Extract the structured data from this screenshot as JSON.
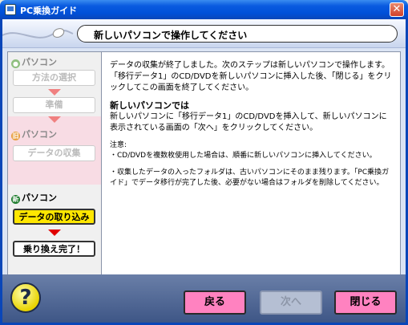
{
  "window": {
    "title": "PC乗換ガイド"
  },
  "header": {
    "title": "新しいパソコンで操作してください"
  },
  "sidebar": {
    "old_label": "パソコン",
    "old_badge": "旧",
    "new_label": "パソコン",
    "new_badge": "新",
    "steps": [
      "方法の選択",
      "準備",
      "データの収集",
      "データの取り込み",
      "乗り換え完了！"
    ]
  },
  "content": {
    "p1": "データの収集が終了しました。次のステップは新しいパソコンで操作します。「移行データ1」のCD/DVDを新しいパソコンに挿入した後、「閉じる」をクリックしてこの画面を終了してください。",
    "heading": "新しいパソコンでは",
    "p2": "新しいパソコンに「移行データ1」のCD/DVDを挿入して、新しいパソコンに表示されている画面の「次へ」をクリックしてください。",
    "note_title": "注意:",
    "note1": "・CD/DVDを複数枚使用した場合は、順番に新しいパソコンに挿入してください。",
    "note2": "・収集したデータの入ったフォルダは、古いパソコンにそのまま残ります。「PC乗換ガイド」でデータ移行が完了した後、必要がない場合はフォルダを削除してください。"
  },
  "buttons": {
    "back": "戻る",
    "next": "次へ",
    "close": "閉じる",
    "help": "?"
  }
}
